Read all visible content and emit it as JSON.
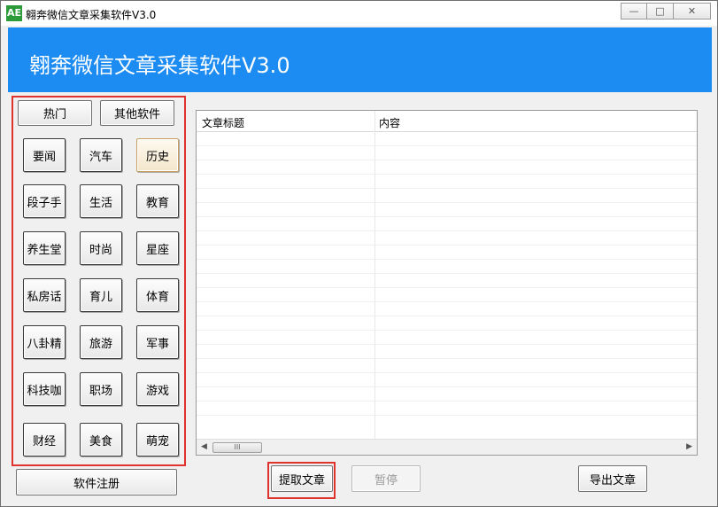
{
  "window": {
    "title": "翱奔微信文章采集软件V3.0",
    "icon_text": "AE",
    "controls": {
      "minimize": "—",
      "maximize": "□",
      "close": "✕"
    }
  },
  "banner": {
    "title": "翱奔微信文章采集软件V3.0"
  },
  "top_buttons": {
    "hot": "热门",
    "other_software": "其他软件"
  },
  "categories": [
    "要闻",
    "汽车",
    "历史",
    "段子手",
    "生活",
    "教育",
    "养生堂",
    "时尚",
    "星座",
    "私房话",
    "育儿",
    "体育",
    "八卦精",
    "旅游",
    "军事",
    "科技咖",
    "职场",
    "游戏",
    "财经",
    "美食",
    "萌宠"
  ],
  "selected_category": "历史",
  "register_button": "软件注册",
  "list": {
    "columns": [
      "文章标题",
      "内容"
    ],
    "scroll_thumb": "III",
    "scroll_left": "◀",
    "scroll_right": "▶"
  },
  "actions": {
    "fetch": "提取文章",
    "pause": "暂停",
    "export": "导出文章"
  },
  "colors": {
    "banner": "#1c8bf2",
    "highlight": "#e0332d"
  }
}
